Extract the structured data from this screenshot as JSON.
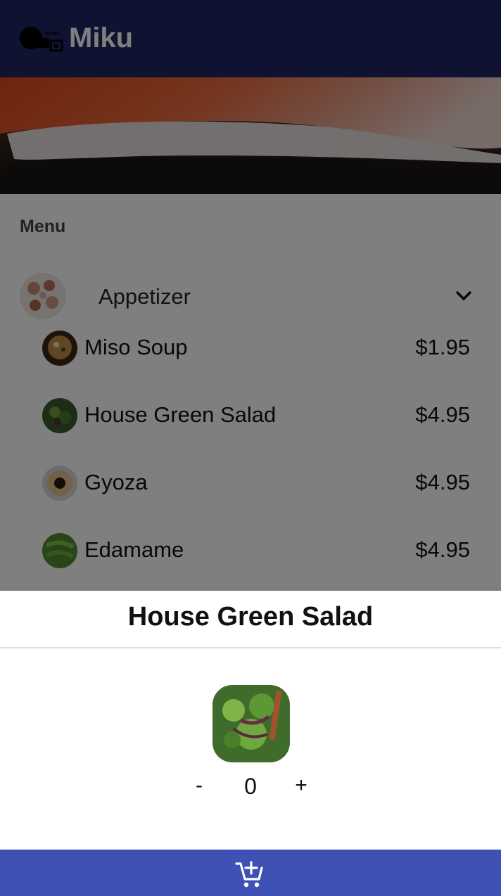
{
  "header": {
    "title": "Miku",
    "logo_icon": "order-qr-logo-icon"
  },
  "menu": {
    "section_title": "Menu",
    "category": {
      "label": "Appetizer"
    },
    "items": [
      {
        "name": "Miso Soup",
        "price": "$1.95"
      },
      {
        "name": "House Green Salad",
        "price": "$4.95"
      },
      {
        "name": "Gyoza",
        "price": "$4.95"
      },
      {
        "name": "Edamame",
        "price": "$4.95"
      }
    ]
  },
  "sheet": {
    "title": "House Green Salad",
    "minus_label": "-",
    "quantity": "0",
    "plus_label": "+"
  },
  "add_to_cart": {
    "icon": "add-shopping-cart-icon"
  },
  "colors": {
    "header_bg": "#1f2460",
    "button_bg": "#3f51b5",
    "overlay": "rgba(0,0,0,0.5)"
  }
}
